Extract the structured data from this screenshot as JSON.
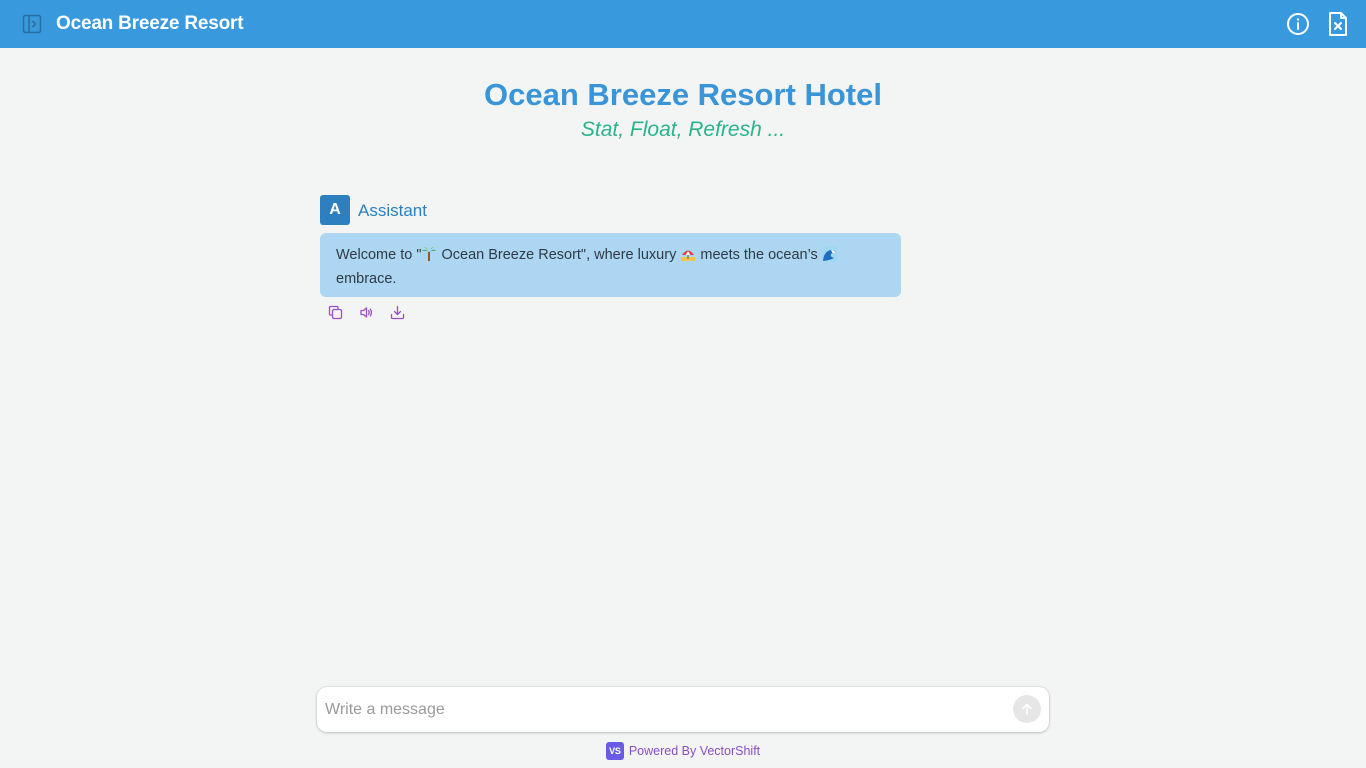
{
  "header": {
    "app_title": "Ocean Breeze Resort",
    "icons": {
      "sidebar_toggle": "sidebar-toggle-icon",
      "info": "info-icon",
      "clear_chat": "clear-chat-icon"
    }
  },
  "hero": {
    "title": "Ocean Breeze Resort Hotel",
    "subtitle": "Stat, Float, Refresh ..."
  },
  "conversation": {
    "messages": [
      {
        "avatar_letter": "A",
        "sender": "Assistant",
        "parts": {
          "p1": "Welcome to \"",
          "p2": " Ocean Breeze Resort\", where luxury ",
          "p3": " meets the ocean’s ",
          "p4": " embrace."
        },
        "emojis": [
          "palm-tree",
          "beach-umbrella",
          "wave"
        ],
        "actions": [
          "copy-icon",
          "speaker-icon",
          "download-icon"
        ]
      }
    ]
  },
  "composer": {
    "placeholder": "Write a message",
    "value": ""
  },
  "footer": {
    "logo_text": "VS",
    "powered_by": "Powered By VectorShift"
  },
  "colors": {
    "header_bg": "#3899dc",
    "title": "#3a94d8",
    "subtitle": "#2ab38a",
    "bubble": "#acd6f2",
    "avatar": "#2e7fbf",
    "actions": "#9b4fc9",
    "footer_text": "#8b4fc1"
  }
}
